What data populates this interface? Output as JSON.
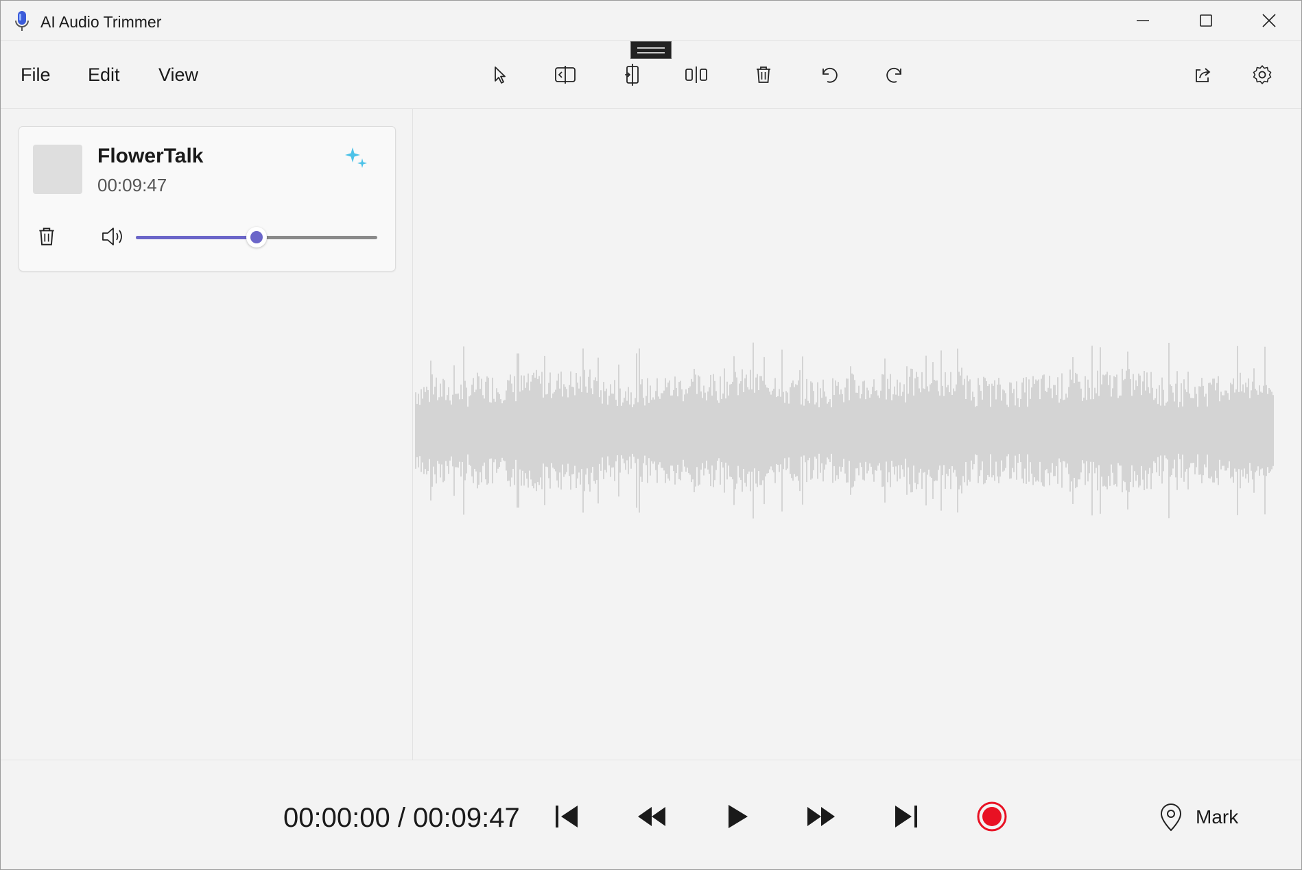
{
  "window": {
    "title": "AI Audio Trimmer",
    "controls": [
      "minimize-icon",
      "maximize-icon",
      "close-icon"
    ]
  },
  "menu": {
    "items": [
      "File",
      "Edit",
      "View"
    ]
  },
  "toolbar": {
    "tools": [
      "select-cursor-icon",
      "split-icon",
      "trim-icon",
      "cut-icon",
      "delete-icon",
      "undo-icon",
      "redo-icon"
    ],
    "right_tools": [
      "share-icon",
      "settings-icon"
    ]
  },
  "track": {
    "name": "FlowerTalk",
    "duration": "00:09:47",
    "volume_fraction": 0.5
  },
  "transport": {
    "time": "00:00:00 / 00:09:47",
    "mark_label": "Mark",
    "buttons": [
      "skip-to-start-icon",
      "rewind-icon",
      "play-icon",
      "fast-forward-icon",
      "skip-to-end-icon",
      "record-icon"
    ]
  },
  "colors": {
    "accent": "#6b66c9",
    "record": "#e81123",
    "waveform": "#d4d4d4",
    "ai_sparkle": "#4cc2e8"
  }
}
